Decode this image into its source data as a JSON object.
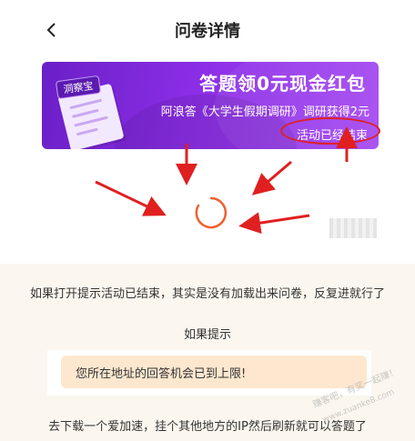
{
  "header": {
    "title": "问卷详情"
  },
  "banner": {
    "badge": "洞察宝",
    "title": "答题领0元现金红包",
    "subtitle": "阿浪答《大学生假期调研》调研获得2元",
    "status": "活动已经结束"
  },
  "notes": {
    "line1": "如果打开提示活动已结束，其实是没有加载出来问卷，反复进就行了",
    "line2": "如果提示",
    "tip": "您所在地址的回答机会已到上限!",
    "line3": "去下载一个爱加速，挂个其他地方的IP然后刷新就可以答题了"
  },
  "watermark": {
    "line1": "赚客吧，有奖一起赚！",
    "line2": "www.zuanke8.com"
  },
  "colors": {
    "annotation": "#e02020",
    "banner": "#7b26d8",
    "spinner": "#f06030",
    "tip_bg": "#fde7cf",
    "lower_bg": "#fbf7ef"
  },
  "icons": {
    "back": "chevron-left-icon",
    "loading": "loading-spinner-icon"
  }
}
